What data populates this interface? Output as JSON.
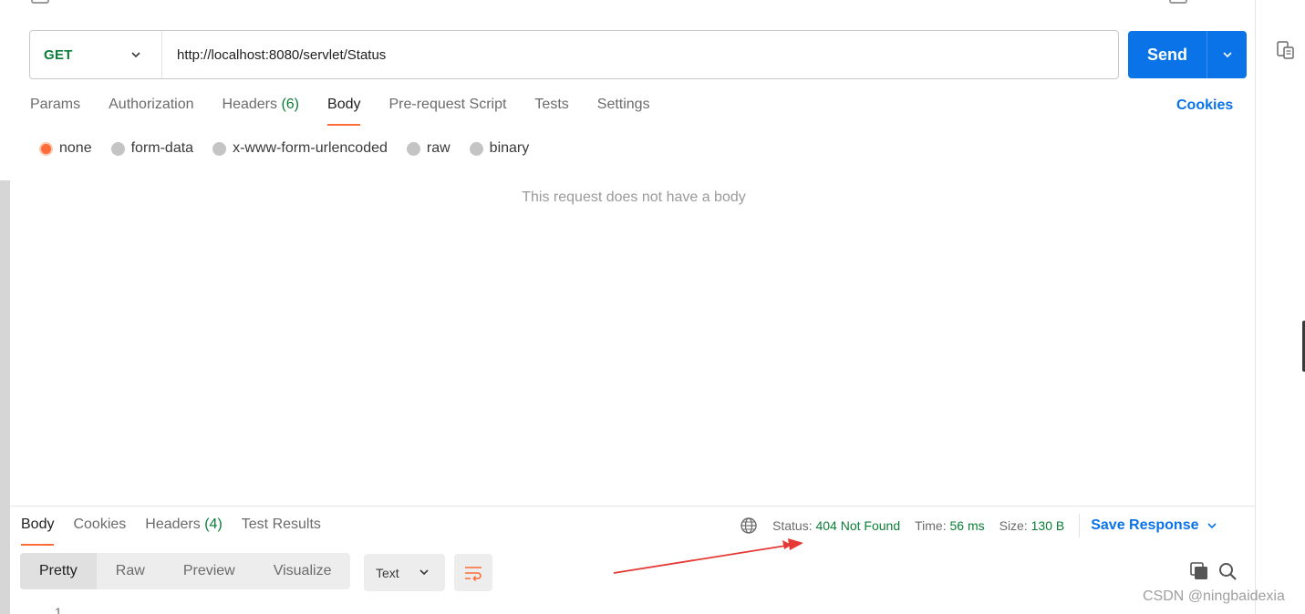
{
  "request": {
    "method": "GET",
    "url": "http://localhost:8080/servlet/Status",
    "send_label": "Send"
  },
  "request_tabs": [
    {
      "label": "Params"
    },
    {
      "label": "Authorization"
    },
    {
      "label": "Headers",
      "count": "(6)"
    },
    {
      "label": "Body",
      "active": true
    },
    {
      "label": "Pre-request Script"
    },
    {
      "label": "Tests"
    },
    {
      "label": "Settings"
    }
  ],
  "cookies_label": "Cookies",
  "body_options": [
    {
      "label": "none",
      "selected": true
    },
    {
      "label": "form-data"
    },
    {
      "label": "x-www-form-urlencoded"
    },
    {
      "label": "raw"
    },
    {
      "label": "binary"
    }
  ],
  "empty_body_message": "This request does not have a body",
  "response": {
    "tabs": [
      {
        "label": "Body",
        "active": true
      },
      {
        "label": "Cookies"
      },
      {
        "label": "Headers",
        "count": "(4)"
      },
      {
        "label": "Test Results"
      }
    ],
    "status_label": "Status:",
    "status_value": "404 Not Found",
    "time_label": "Time:",
    "time_value": "56 ms",
    "size_label": "Size:",
    "size_value": "130 B",
    "save_label": "Save Response",
    "view_tabs": [
      {
        "label": "Pretty",
        "active": true
      },
      {
        "label": "Raw"
      },
      {
        "label": "Preview"
      },
      {
        "label": "Visualize"
      }
    ],
    "format": "Text",
    "line_number": "1"
  },
  "watermark": "CSDN @ningbaidexia",
  "colors": {
    "accent_orange": "#ff6c37",
    "send_blue": "#0a73e8",
    "status_green": "#0a7d36",
    "annotation_red": "#e53935"
  },
  "icons": [
    "chevron-down-icon",
    "globe-icon",
    "wrap-lines-icon",
    "copy-icon",
    "search-icon",
    "document-icon"
  ]
}
